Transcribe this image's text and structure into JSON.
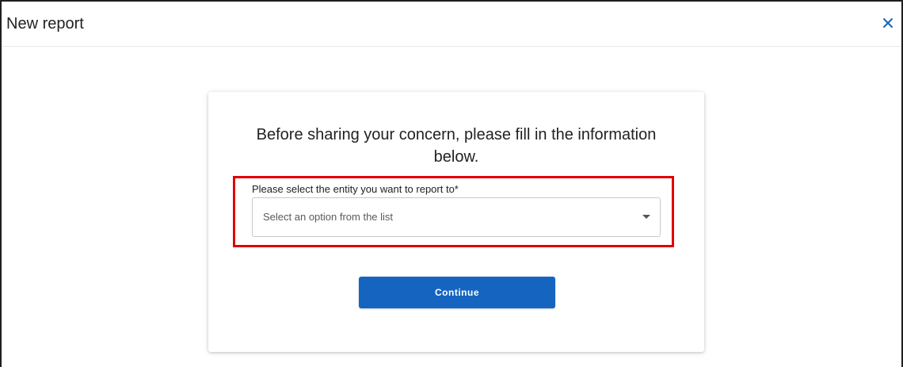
{
  "dialog": {
    "title": "New report",
    "close_icon": "close-icon"
  },
  "form": {
    "heading": "Before sharing your concern, please fill in the information below.",
    "entity_label": "Please select the entity you want to report to*",
    "entity_placeholder": "Select an option from the list",
    "entity_value": "",
    "continue_label": "Continue"
  },
  "colors": {
    "primary": "#1565c0",
    "highlight": "#e00000",
    "close_icon": "#1565c0"
  }
}
